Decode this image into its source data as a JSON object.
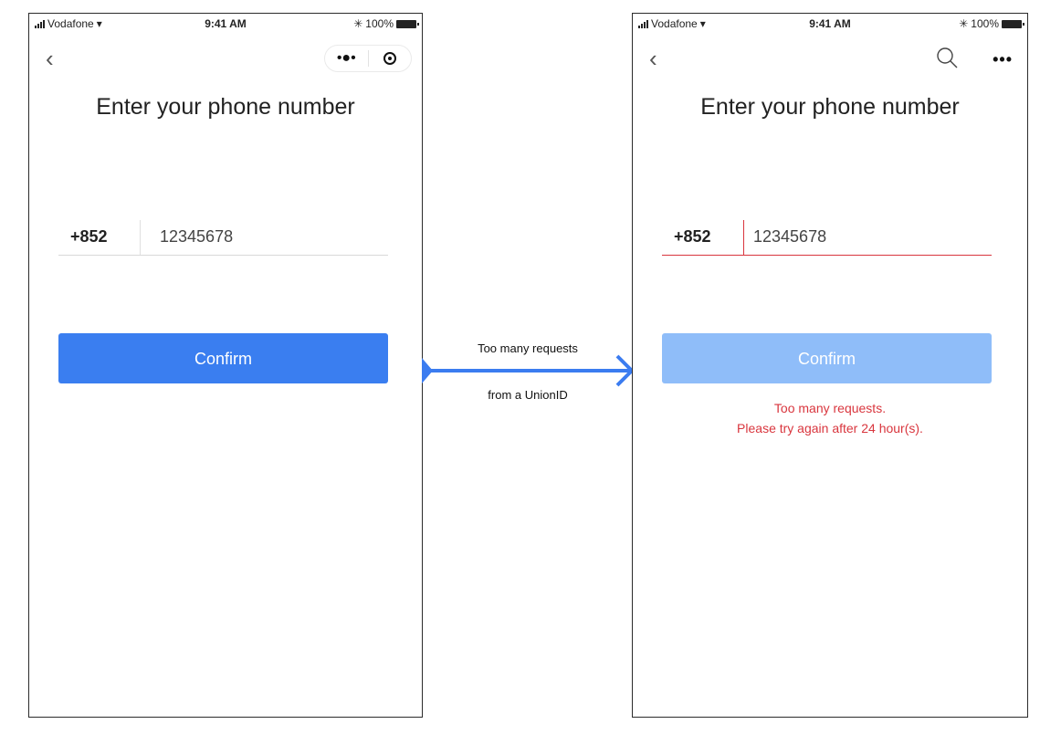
{
  "status_bar": {
    "carrier": "Vodafone",
    "time": "9:41 AM",
    "battery": "100%"
  },
  "left_screen": {
    "title": "Enter your phone number",
    "country_code": "+852",
    "phone_number": "12345678",
    "confirm_label": "Confirm"
  },
  "transition": {
    "line1": "Too many requests",
    "line2": "from a UnionID",
    "arrow_color": "#3b7cf0"
  },
  "right_screen": {
    "title": "Enter your phone number",
    "country_code": "+852",
    "phone_number": "12345678",
    "confirm_label": "Confirm",
    "error_line1": "Too many requests.",
    "error_line2": "Please try again after 24 hour(s)."
  },
  "colors": {
    "primary": "#3a7ef0",
    "primary_disabled": "#8fbdf9",
    "error": "#d9363e"
  },
  "icons": [
    "back-icon",
    "more-icon",
    "target-icon",
    "search-icon",
    "wifi-icon",
    "bluetooth-icon",
    "battery-icon"
  ]
}
